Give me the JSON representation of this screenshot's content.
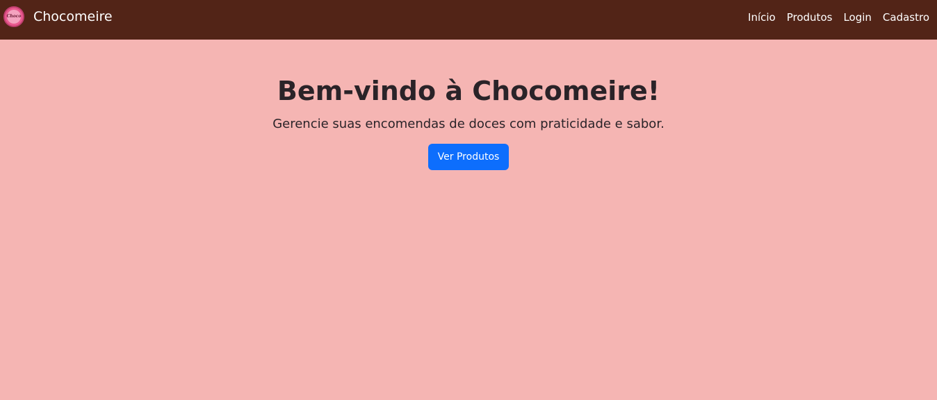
{
  "navbar": {
    "brand_name": "Chocomeire",
    "logo_text": "Choco",
    "background_color": "#522417",
    "links": [
      {
        "label": "Início"
      },
      {
        "label": "Produtos"
      },
      {
        "label": "Login"
      },
      {
        "label": "Cadastro"
      }
    ]
  },
  "hero": {
    "title": "Bem-vindo à Chocomeire!",
    "subtitle": "Gerencie suas encomendas de doces com praticidade e sabor.",
    "cta_label": "Ver Produtos",
    "cta_color": "#0d6efd"
  },
  "page": {
    "background_color": "#f5b5b3"
  }
}
